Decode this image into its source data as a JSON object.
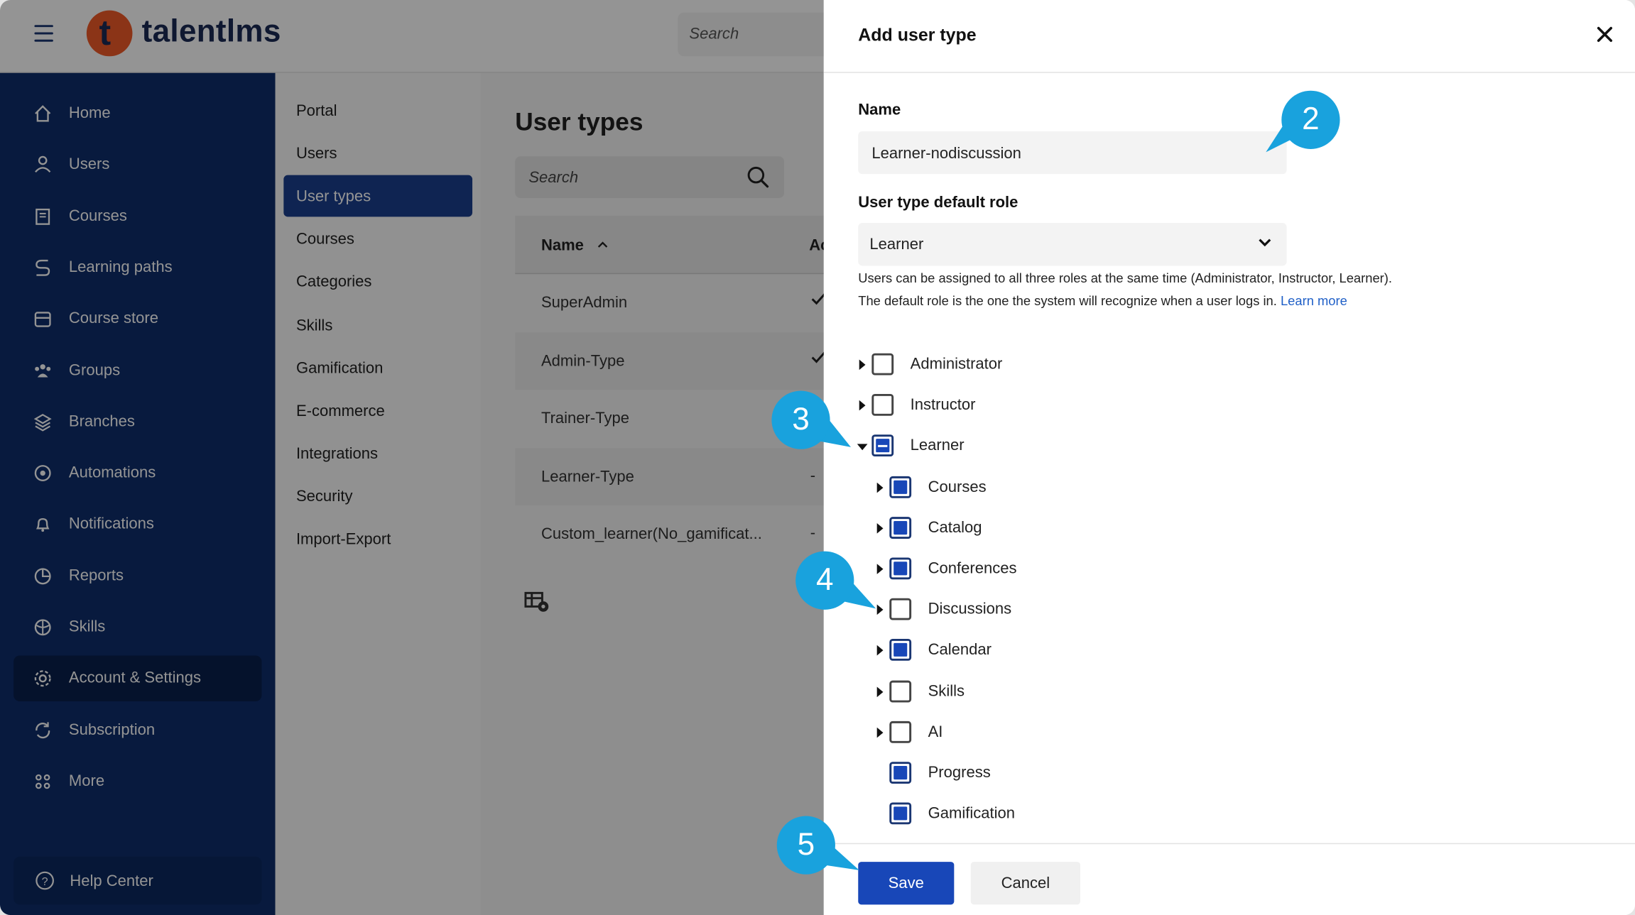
{
  "topbar": {
    "logo_letter": "t",
    "logo_text": "talentlms",
    "search_placeholder": "Search"
  },
  "sidebar": {
    "items": [
      {
        "label": "Home",
        "icon": "home-icon"
      },
      {
        "label": "Users",
        "icon": "user-icon"
      },
      {
        "label": "Courses",
        "icon": "book-icon"
      },
      {
        "label": "Learning paths",
        "icon": "path-icon"
      },
      {
        "label": "Course store",
        "icon": "store-icon"
      },
      {
        "label": "Groups",
        "icon": "groups-icon"
      },
      {
        "label": "Branches",
        "icon": "layers-icon"
      },
      {
        "label": "Automations",
        "icon": "automation-icon"
      },
      {
        "label": "Notifications",
        "icon": "bell-icon"
      },
      {
        "label": "Reports",
        "icon": "pie-chart-icon"
      },
      {
        "label": "Skills",
        "icon": "skills-icon"
      },
      {
        "label": "Account & Settings",
        "icon": "gear-icon"
      },
      {
        "label": "Subscription",
        "icon": "subscription-icon"
      },
      {
        "label": "More",
        "icon": "grid-dots-icon"
      }
    ],
    "active_index": 11,
    "help_label": "Help Center"
  },
  "settings_menu": {
    "items": [
      "Portal",
      "Users",
      "User types",
      "Courses",
      "Categories",
      "Skills",
      "Gamification",
      "E-commerce",
      "Integrations",
      "Security",
      "Import-Export"
    ],
    "active_index": 2
  },
  "user_types": {
    "title": "User types",
    "search_placeholder": "Search",
    "col_name": "Name",
    "col_next": "Ac",
    "rows": [
      {
        "name": "SuperAdmin",
        "mark": "check"
      },
      {
        "name": "Admin-Type",
        "mark": "check"
      },
      {
        "name": "Trainer-Type",
        "mark": ""
      },
      {
        "name": "Learner-Type",
        "mark": "-"
      },
      {
        "name": "Custom_learner(No_gamificat...",
        "mark": "-"
      }
    ]
  },
  "drawer": {
    "title": "Add user type",
    "name_label": "Name",
    "name_value": "Learner-nodiscussion",
    "role_label": "User type default role",
    "role_value": "Learner",
    "hint_line1": "Users can be assigned to all three roles at the same time (Administrator, Instructor, Learner).",
    "hint_line2": "The default role is the one the system will recognize when a user logs in.",
    "hint_link": "Learn more",
    "permissions": [
      {
        "label": "Administrator",
        "state": "unchecked",
        "caret": "right",
        "level": 0
      },
      {
        "label": "Instructor",
        "state": "unchecked",
        "caret": "right",
        "level": 0
      },
      {
        "label": "Learner",
        "state": "partial",
        "caret": "down",
        "level": 0
      },
      {
        "label": "Courses",
        "state": "checked",
        "caret": "right",
        "level": 1
      },
      {
        "label": "Catalog",
        "state": "checked",
        "caret": "right",
        "level": 1
      },
      {
        "label": "Conferences",
        "state": "checked",
        "caret": "right",
        "level": 1
      },
      {
        "label": "Discussions",
        "state": "unchecked",
        "caret": "right",
        "level": 1
      },
      {
        "label": "Calendar",
        "state": "checked",
        "caret": "right",
        "level": 1
      },
      {
        "label": "Skills",
        "state": "unchecked",
        "caret": "right",
        "level": 1
      },
      {
        "label": "AI",
        "state": "unchecked",
        "caret": "right",
        "level": 1
      },
      {
        "label": "Progress",
        "state": "checked",
        "caret": "none",
        "level": 1
      },
      {
        "label": "Gamification",
        "state": "checked",
        "caret": "none",
        "level": 1
      }
    ],
    "save_label": "Save",
    "cancel_label": "Cancel"
  },
  "callouts": [
    "2",
    "3",
    "4",
    "5"
  ],
  "colors": {
    "sidebar": "#0e2d6b",
    "sidebar_active": "#0a1f4d",
    "accent": "#1847b8",
    "logo": "#f05a28",
    "callout": "#19a2dd"
  }
}
